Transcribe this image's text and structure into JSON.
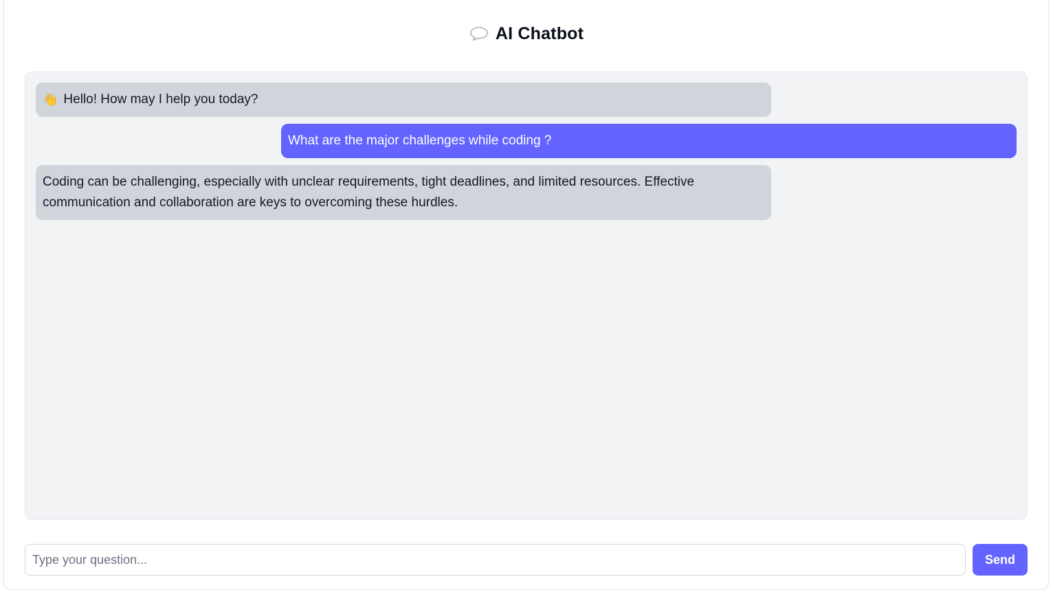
{
  "header": {
    "icon": "speech-bubble-icon",
    "title": "AI Chatbot"
  },
  "messages": [
    {
      "role": "bot",
      "icon": "waving-hand-icon",
      "text": "Hello! How may I help you today?"
    },
    {
      "role": "user",
      "text": "What are the major challenges while coding ?"
    },
    {
      "role": "bot",
      "text": "Coding can be challenging, especially with unclear requirements, tight deadlines, and limited resources. Effective communication and collaboration are keys to overcoming these hurdles."
    }
  ],
  "composer": {
    "value": "",
    "placeholder": "Type your question...",
    "send_label": "Send"
  },
  "colors": {
    "accent": "#6363ff",
    "bot_bubble": "#d1d5db",
    "chat_bg": "#f2f3f5"
  }
}
